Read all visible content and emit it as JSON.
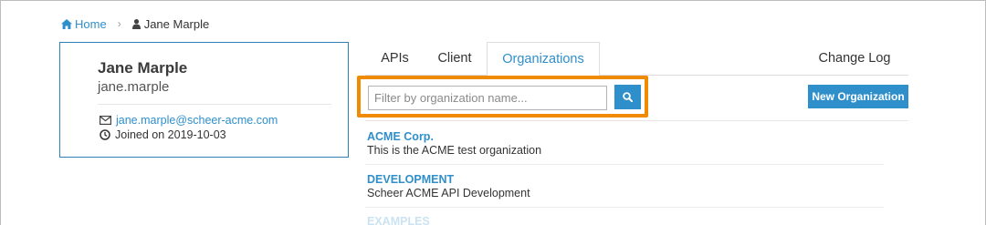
{
  "breadcrumb": {
    "home_label": "Home",
    "separator": "›",
    "current_user": "Jane Marple"
  },
  "user_card": {
    "name": "Jane Marple",
    "username": "jane.marple",
    "email": "jane.marple@scheer-acme.com",
    "joined": "Joined on 2019-10-03"
  },
  "tabs": [
    {
      "label": "APIs"
    },
    {
      "label": "Client"
    },
    {
      "label": "Organizations",
      "active": true
    },
    {
      "label": "Change Log"
    }
  ],
  "filter": {
    "placeholder": "Filter by organization name...",
    "value": ""
  },
  "new_org_label": "New Organization",
  "organizations": [
    {
      "name": "ACME Corp.",
      "description": "This is the ACME test organization"
    },
    {
      "name": "DEVELOPMENT",
      "description": "Scheer ACME API Development"
    },
    {
      "name": "EXAMPLES",
      "description": ""
    }
  ],
  "colors": {
    "accent": "#2f8fcb",
    "highlight": "#f08a00",
    "card_border": "#2f7fb6"
  },
  "icons": {
    "home": "home-icon",
    "user": "user-icon",
    "email": "envelope-icon",
    "joined": "clock-icon",
    "search": "search-icon"
  }
}
